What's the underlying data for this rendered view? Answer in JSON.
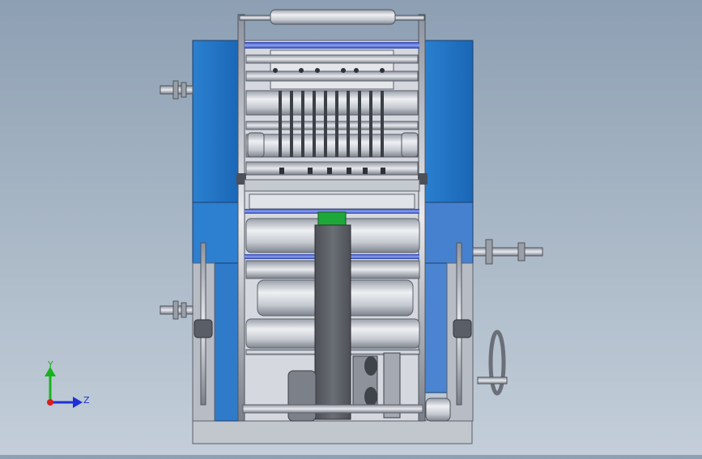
{
  "viewport": {
    "background_top": "#8d9fb3",
    "background_bottom": "#c3ced9",
    "model_colors": {
      "side_panel_blue": "#1f73c4",
      "side_panel_blue_dark": "#1558a0",
      "side_panel_light": "#4a86d0",
      "steel": "#c9ccd3",
      "steel_dark": "#7d828c",
      "roller_blue_strip": "#3c5ec8",
      "green_block": "#1fa83a",
      "dark_column": "#5a5d63",
      "base": "#bfc3ca"
    }
  },
  "triad": {
    "y_label": "Y",
    "z_label": "Z",
    "y_color": "#19b21f",
    "z_color": "#1f2fd6",
    "x_color": "#d61f1f",
    "icon": "coordinate-triad-icon"
  }
}
